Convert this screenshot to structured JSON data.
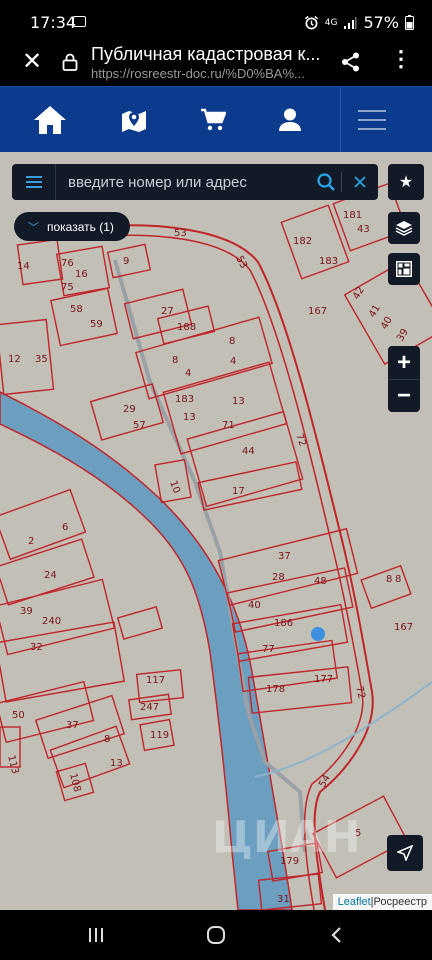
{
  "status_bar": {
    "time": "17:34",
    "network": "4G",
    "battery": "57%"
  },
  "browser": {
    "title": "Публичная кадастровая к...",
    "url": "https://rosreestr-doc.ru/%D0%BA%..."
  },
  "app_nav": {
    "items": [
      "home-icon",
      "map-marker-icon",
      "cart-icon",
      "user-icon",
      "hamburger-menu-icon"
    ]
  },
  "search": {
    "placeholder": "введите номер или адрес",
    "value": ""
  },
  "show_chip": {
    "label": "показать (1)"
  },
  "zoom": {
    "in_label": "+",
    "out_label": "−"
  },
  "attribution": {
    "leaflet": "Leaflet",
    "separator": " | ",
    "provider": "Росреестр"
  },
  "map": {
    "colors": {
      "background": "#c2bfb6",
      "parcel_border": "#c0252a",
      "river": "#6c9fbf",
      "road": "#9aa1a6",
      "stream": "#8cb4cc",
      "location_dot": "#3d8fe0"
    },
    "parcel_labels": [
      "53",
      "53",
      "181",
      "43",
      "182",
      "183",
      "76",
      "16",
      "75",
      "9",
      "14",
      "58",
      "59",
      "27",
      "188",
      "167",
      "42",
      "41",
      "40",
      "39",
      "12",
      "35",
      "8",
      "8",
      "4",
      "4",
      "183",
      "29",
      "57",
      "13",
      "13",
      "71",
      "72",
      "44",
      "10",
      "17",
      "6",
      "2",
      "24",
      "37",
      "28",
      "48",
      "8",
      "39",
      "240",
      "40",
      "186",
      "167",
      "32",
      "77",
      "117",
      "247",
      "178",
      "177",
      "72",
      "50",
      "37",
      "8",
      "119",
      "113",
      "108",
      "13",
      "54",
      "5",
      "179",
      "31",
      "8"
    ]
  },
  "watermark": "ЦИАН"
}
